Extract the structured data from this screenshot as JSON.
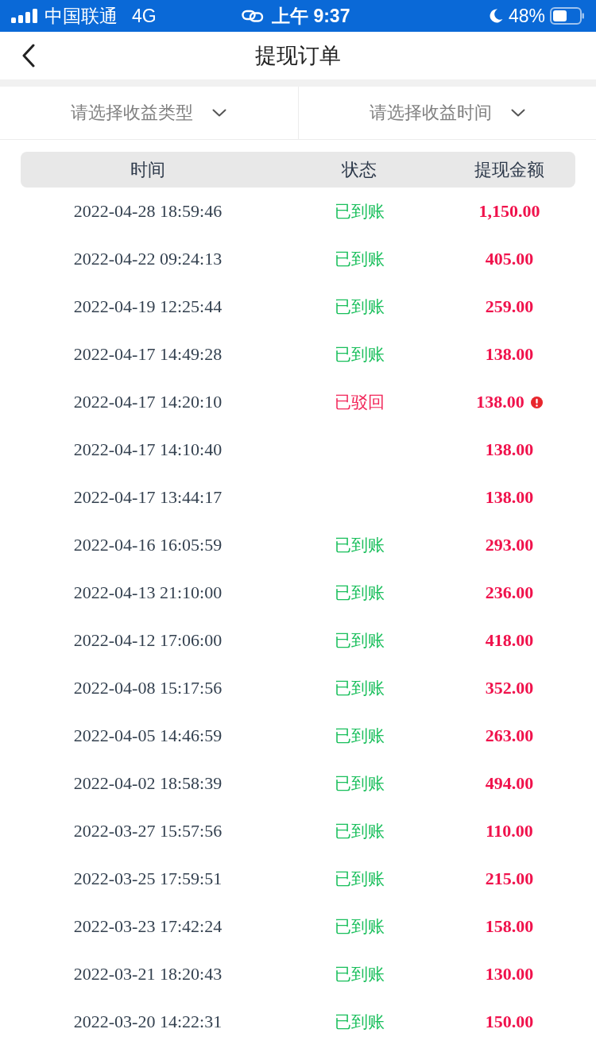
{
  "status_bar": {
    "carrier": "中国联通",
    "network": "4G",
    "time": "上午 9:37",
    "battery": "48%"
  },
  "nav": {
    "title": "提现订单"
  },
  "filters": [
    {
      "label": "请选择收益类型"
    },
    {
      "label": "请选择收益时间"
    }
  ],
  "table": {
    "columns": [
      "时间",
      "状态",
      "提现金额"
    ],
    "rows": [
      {
        "time": "2022-04-28 18:59:46",
        "status": {
          "text": "已到账",
          "kind": "arrived"
        },
        "amount": "1,150.00",
        "alert": false
      },
      {
        "time": "2022-04-22 09:24:13",
        "status": {
          "text": "已到账",
          "kind": "arrived"
        },
        "amount": "405.00",
        "alert": false
      },
      {
        "time": "2022-04-19 12:25:44",
        "status": {
          "text": "已到账",
          "kind": "arrived"
        },
        "amount": "259.00",
        "alert": false
      },
      {
        "time": "2022-04-17 14:49:28",
        "status": {
          "text": "已到账",
          "kind": "arrived"
        },
        "amount": "138.00",
        "alert": false
      },
      {
        "time": "2022-04-17 14:20:10",
        "status": {
          "text": "已驳回",
          "kind": "rejected"
        },
        "amount": "138.00",
        "alert": true
      },
      {
        "time": "2022-04-17 14:10:40",
        "amount": "138.00",
        "alert": false
      },
      {
        "time": "2022-04-17 13:44:17",
        "amount": "138.00",
        "alert": false
      },
      {
        "time": "2022-04-16 16:05:59",
        "status": {
          "text": "已到账",
          "kind": "arrived"
        },
        "amount": "293.00",
        "alert": false
      },
      {
        "time": "2022-04-13 21:10:00",
        "status": {
          "text": "已到账",
          "kind": "arrived"
        },
        "amount": "236.00",
        "alert": false
      },
      {
        "time": "2022-04-12 17:06:00",
        "status": {
          "text": "已到账",
          "kind": "arrived"
        },
        "amount": "418.00",
        "alert": false
      },
      {
        "time": "2022-04-08 15:17:56",
        "status": {
          "text": "已到账",
          "kind": "arrived"
        },
        "amount": "352.00",
        "alert": false
      },
      {
        "time": "2022-04-05 14:46:59",
        "status": {
          "text": "已到账",
          "kind": "arrived"
        },
        "amount": "263.00",
        "alert": false
      },
      {
        "time": "2022-04-02 18:58:39",
        "status": {
          "text": "已到账",
          "kind": "arrived"
        },
        "amount": "494.00",
        "alert": false
      },
      {
        "time": "2022-03-27 15:57:56",
        "status": {
          "text": "已到账",
          "kind": "arrived"
        },
        "amount": "110.00",
        "alert": false
      },
      {
        "time": "2022-03-25 17:59:51",
        "status": {
          "text": "已到账",
          "kind": "arrived"
        },
        "amount": "215.00",
        "alert": false
      },
      {
        "time": "2022-03-23 17:42:24",
        "status": {
          "text": "已到账",
          "kind": "arrived"
        },
        "amount": "158.00",
        "alert": false
      },
      {
        "time": "2022-03-21 18:20:43",
        "status": {
          "text": "已到账",
          "kind": "arrived"
        },
        "amount": "130.00",
        "alert": false
      },
      {
        "time": "2022-03-20 14:22:31",
        "status": {
          "text": "已到账",
          "kind": "arrived"
        },
        "amount": "150.00",
        "alert": false
      }
    ]
  }
}
